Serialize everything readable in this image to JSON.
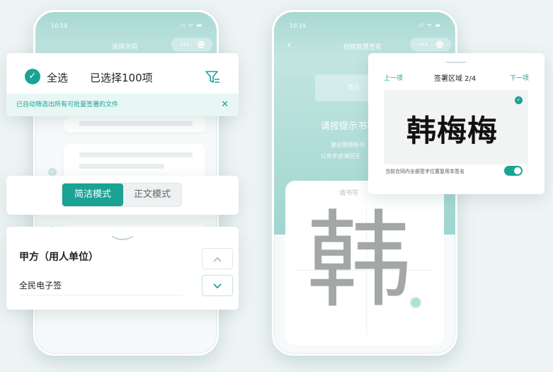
{
  "phone1": {
    "time": "10:19",
    "signal": ".ıl ᯤ ▬",
    "title": "选择合同",
    "capsule_dots": "•••"
  },
  "select_card": {
    "select_all_label": "全选",
    "selected_count_text": "已选择100项",
    "notice_text": "已自动筛选出所有可批量签署的文件",
    "close_glyph": "✕"
  },
  "mode_toggle": {
    "options": [
      "简洁模式",
      "正文模式"
    ],
    "active": "简洁模式"
  },
  "party_card": {
    "party_title": "甲方（用人单位）",
    "party_value": "全民电子签",
    "up_glyph": "⌃",
    "down_glyph": "⌄"
  },
  "phone2": {
    "time": "10:19",
    "signal": ".ıl ᯤ ▬",
    "title": "创建智慧签名",
    "back_glyph": "‹",
    "capsule_dots": "•••",
    "faded_button": "签名",
    "prompt_heading": "请按提示书写",
    "prompt_line1": "建议使用楷书",
    "prompt_line2": "以免字迹潦因无",
    "pad_hint": "请书写",
    "tracing_char": "韩"
  },
  "signature_card": {
    "prev_label": "上一项",
    "region_label": "签署区域 2/4",
    "next_label": "下一项",
    "signature_text": "韩梅梅",
    "apply_all_text": "当前合同内全部签字位置复用本签名",
    "apply_all_on": true
  },
  "colors": {
    "accent": "#1aa295",
    "accent_light": "#e8f7f4",
    "phone_header": "#a8d8d2"
  }
}
